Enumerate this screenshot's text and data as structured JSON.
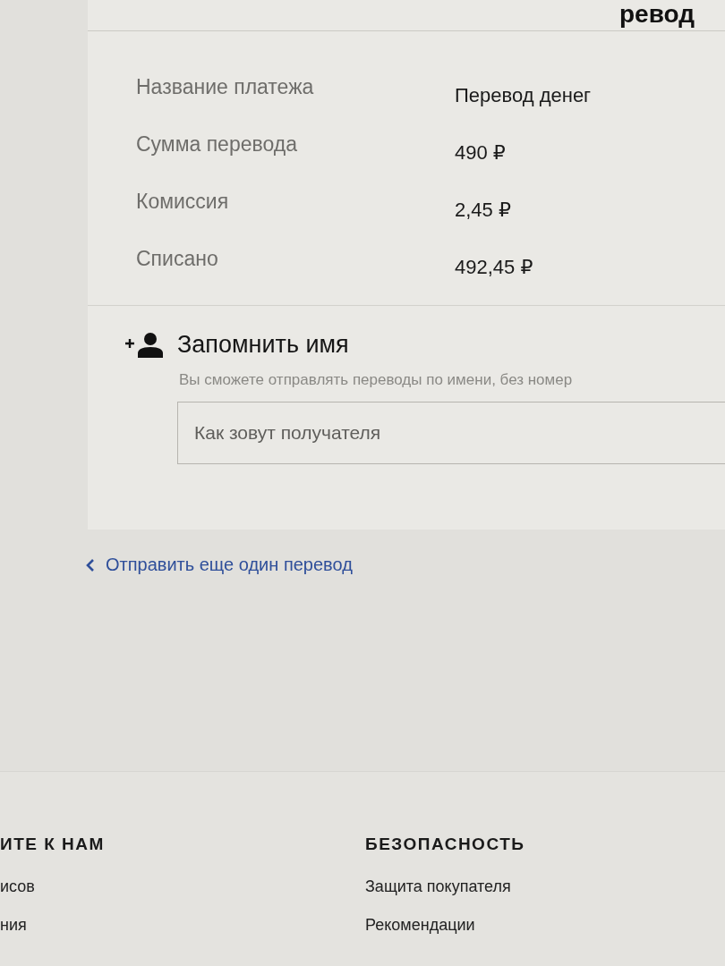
{
  "page": {
    "title": "ревод"
  },
  "payment_details": [
    {
      "label": "Название платежа",
      "value": "Перевод денег"
    },
    {
      "label": "Сумма перевода",
      "value": "490 ₽"
    },
    {
      "label": "Комиссия",
      "value": "2,45 ₽"
    },
    {
      "label": "Списано",
      "value": "492,45 ₽"
    }
  ],
  "remember_name": {
    "title": "Запомнить имя",
    "description": "Вы сможете отправлять переводы по имени, без номер",
    "input": {
      "placeholder": "Как зовут получателя"
    }
  },
  "another_transfer_link": "Отправить еще один перевод",
  "footer": {
    "columns": [
      {
        "heading": "ИТЕ К НАМ",
        "links": [
          "исов",
          "ния"
        ]
      },
      {
        "heading": "БЕЗОПАСНОСТЬ",
        "links": [
          "Защита покупателя",
          "Рекомендации"
        ]
      }
    ]
  }
}
